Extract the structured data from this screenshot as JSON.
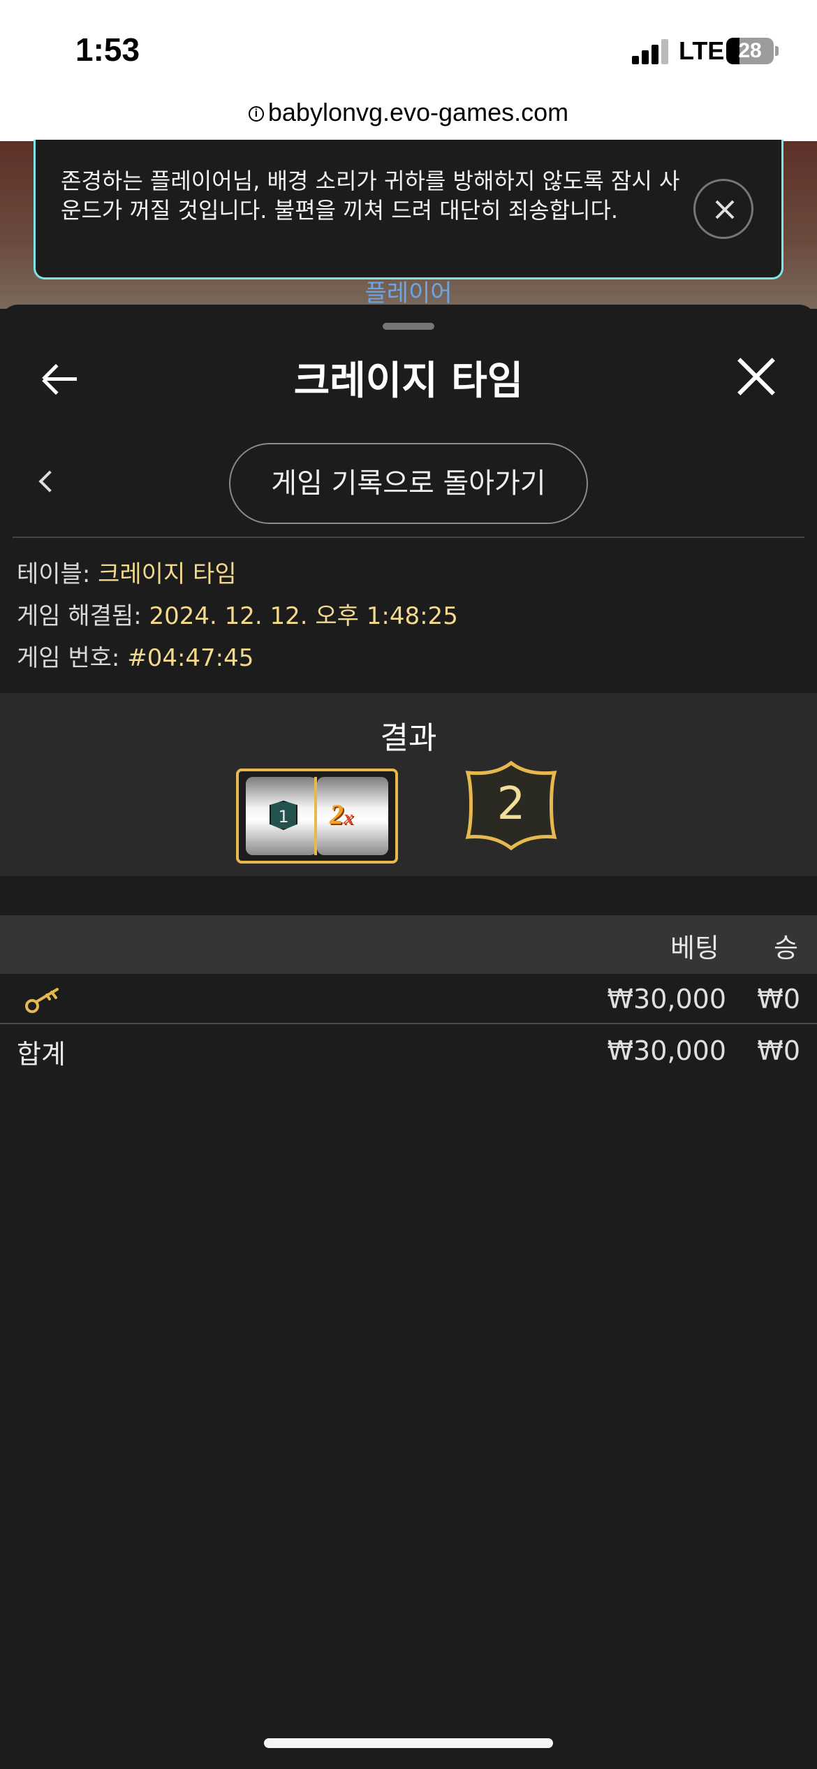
{
  "status_bar": {
    "time": "1:53",
    "network": "LTE",
    "battery": "28",
    "battery_level": 0.28
  },
  "browser": {
    "url": "babylonvg.evo-games.com"
  },
  "background": {
    "player_label": "플레이어"
  },
  "notification": {
    "message": "존경하는 플레이어님, 배경 소리가 귀하를 방해하지 않도록 잠시 사운드가 꺼질 것입니다. 불편을 끼쳐 드려 대단히 죄송합니다."
  },
  "sheet": {
    "title": "크레이지 타임",
    "back_to_history": "게임 기록으로 돌아가기",
    "info": {
      "table_label": "테이블:",
      "table_value": "크레이지 타임",
      "resolved_label": "게임 해결됨:",
      "resolved_value": "2024. 12. 12. 오후 1:48:25",
      "game_no_label": "게임 번호:",
      "game_no_value": "#04:47:45"
    },
    "result": {
      "title": "결과",
      "slot_left": "1",
      "slot_right_multiplier": "2",
      "slot_right_suffix": "x",
      "wheel_number": "2"
    },
    "table": {
      "col_bet": "베팅",
      "col_win": "승",
      "rows": [
        {
          "icon": "key-icon",
          "bet": "₩30,000",
          "win": "₩0"
        }
      ],
      "total": {
        "label": "합계",
        "bet": "₩30,000",
        "win": "₩0"
      }
    }
  },
  "colors": {
    "accent_gold": "#e7b84e",
    "value_yellow": "#f3d98b",
    "banner_border": "#7fe4e6"
  }
}
